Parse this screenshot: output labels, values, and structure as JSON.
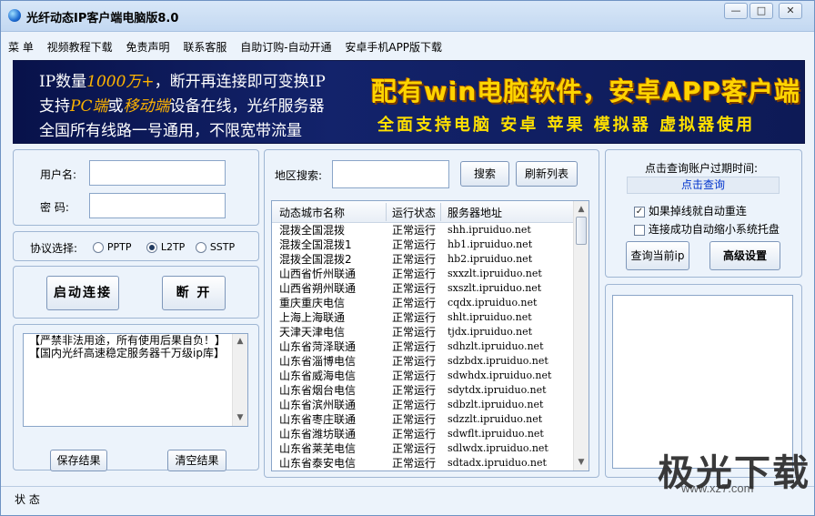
{
  "window": {
    "title": "光纤动态IP客户端电脑版8.0",
    "btn_min": "—",
    "btn_max": "□",
    "btn_close": "✕"
  },
  "menu": [
    "菜 单",
    "视频教程下载",
    "免责声明",
    "联系客服",
    "自助订购-自动开通",
    "安卓手机APP版下载"
  ],
  "banner": {
    "l1a": "IP数量",
    "l1b": "1000万+",
    "l1c": "，断开再连接即可变换IP",
    "l2a": "支持",
    "l2b": "PC端",
    "l2c": "或",
    "l2d": "移动端",
    "l2e": "设备在线，光纤服务器",
    "l3": "全国所有线路一号通用，不限宽带流量",
    "big": "配有win电脑软件，安卓APP客户端",
    "sub": "全面支持电脑 安卓 苹果 模拟器 虚拟器使用"
  },
  "login": {
    "username_label": "用户名:",
    "password_label": "密  码:",
    "username_value": "",
    "password_value": ""
  },
  "protocol": {
    "label": "协议选择:",
    "options": [
      "PPTP",
      "L2TP",
      "SSTP"
    ],
    "selected": "L2TP"
  },
  "actions": {
    "connect": "启动连接",
    "disconnect": "断 开"
  },
  "log": {
    "lines": [
      "【严禁非法用途，所有使用后果自负！】",
      "【国内光纤高速稳定服务器千万级ip库】"
    ],
    "save": "保存结果",
    "clear": "清空结果"
  },
  "servers": {
    "search_label": "地区搜索:",
    "search_value": "",
    "search_button": "搜索",
    "refresh_button": "刷新列表",
    "columns": [
      "动态城市名称",
      "运行状态",
      "服务器地址"
    ],
    "rows": [
      [
        "混拨全国混拨",
        "正常运行",
        "shh.ipruiduo.net"
      ],
      [
        "混拨全国混拨1",
        "正常运行",
        "hb1.ipruiduo.net"
      ],
      [
        "混拨全国混拨2",
        "正常运行",
        "hb2.ipruiduo.net"
      ],
      [
        "山西省忻州联通",
        "正常运行",
        "sxxzlt.ipruiduo.net"
      ],
      [
        "山西省朔州联通",
        "正常运行",
        "sxszlt.ipruiduo.net"
      ],
      [
        "重庆重庆电信",
        "正常运行",
        "cqdx.ipruiduo.net"
      ],
      [
        "上海上海联通",
        "正常运行",
        "shlt.ipruiduo.net"
      ],
      [
        "天津天津电信",
        "正常运行",
        "tjdx.ipruiduo.net"
      ],
      [
        "山东省菏泽联通",
        "正常运行",
        "sdhzlt.ipruiduo.net"
      ],
      [
        "山东省淄博电信",
        "正常运行",
        "sdzbdx.ipruiduo.net"
      ],
      [
        "山东省威海电信",
        "正常运行",
        "sdwhdx.ipruiduo.net"
      ],
      [
        "山东省烟台电信",
        "正常运行",
        "sdytdx.ipruiduo.net"
      ],
      [
        "山东省滨州联通",
        "正常运行",
        "sdbzlt.ipruiduo.net"
      ],
      [
        "山东省枣庄联通",
        "正常运行",
        "sdzzlt.ipruiduo.net"
      ],
      [
        "山东省潍坊联通",
        "正常运行",
        "sdwflt.ipruiduo.net"
      ],
      [
        "山东省莱芜电信",
        "正常运行",
        "sdlwdx.ipruiduo.net"
      ],
      [
        "山东省泰安电信",
        "正常运行",
        "sdtadx.ipruiduo.net"
      ]
    ]
  },
  "account": {
    "expire_label": "点击查询账户过期时间:",
    "query_link": "点击查询",
    "auto_reconnect": "如果掉线就自动重连",
    "auto_reconnect_checked": true,
    "minimize_tray": "连接成功自动缩小系统托盘",
    "minimize_tray_checked": false,
    "query_ip": "查询当前ip",
    "advanced": "高级设置"
  },
  "status": {
    "label": "状 态"
  },
  "watermark": {
    "text": "极光下载",
    "url": "www.xz7.com"
  },
  "colors": {
    "banner_bg": "#0d1a56",
    "banner_highlight": "#ffb400",
    "link_blue": "#0033cc",
    "window_bg": "#ecf3fb"
  }
}
